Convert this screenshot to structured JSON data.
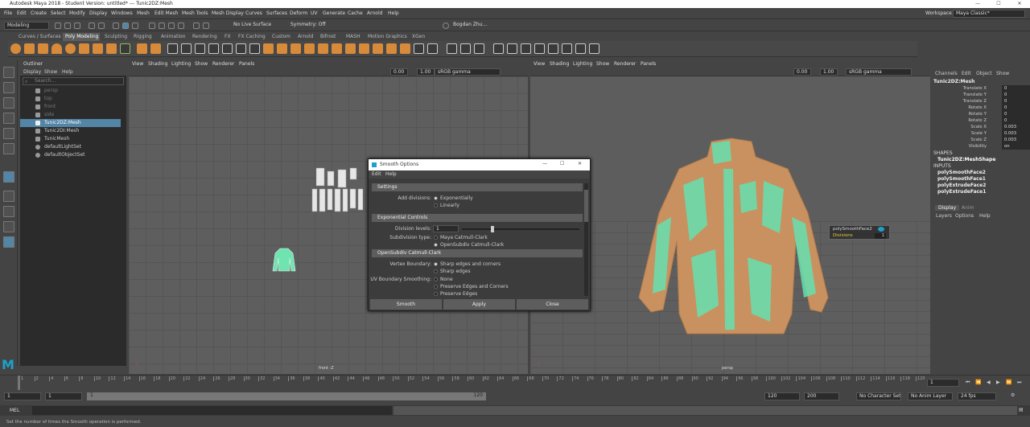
{
  "app": {
    "title": "Autodesk Maya 2018 - Student Version: untitled*   ---   Tunic2DZ:Mesh",
    "accent": "#5285a6"
  },
  "menubar": {
    "items": [
      "File",
      "Edit",
      "Create",
      "Select",
      "Modify",
      "Display",
      "Windows",
      "Mesh",
      "Edit Mesh",
      "Mesh Tools",
      "Mesh Display",
      "Curves",
      "Surfaces",
      "Deform",
      "UV",
      "Generate",
      "Cache",
      "Arnold",
      "Help"
    ],
    "workspace_label": "Workspace :",
    "workspace_value": "Maya Classic*"
  },
  "statusline": {
    "mode": "Modeling",
    "live_surface": "No Live Surface",
    "symmetry": "Symmetry: Off",
    "user": "Bogdan Zhu..."
  },
  "shelf": {
    "tabs": [
      "Curves / Surfaces",
      "Poly Modeling",
      "Sculpting",
      "Rigging",
      "Animation",
      "Rendering",
      "FX",
      "FX Caching",
      "Custom",
      "Arnold",
      "Bifrost",
      "MASH",
      "Motion Graphics",
      "XGen"
    ],
    "active_tab": "Poly Modeling"
  },
  "outliner": {
    "title": "Outliner",
    "menu": [
      "Display",
      "Show",
      "Help"
    ],
    "search_placeholder": "Search...",
    "items": [
      {
        "label": "persp",
        "state": "dim"
      },
      {
        "label": "top",
        "state": "dim"
      },
      {
        "label": "front",
        "state": "dim"
      },
      {
        "label": "side",
        "state": "dim"
      },
      {
        "label": "Tunic2DZ:Mesh",
        "state": "selected"
      },
      {
        "label": "Tunic2DI:Mesh",
        "state": "normal"
      },
      {
        "label": "TunicMesh",
        "state": "normal"
      },
      {
        "label": "defaultLightSet",
        "state": "normal"
      },
      {
        "label": "defaultObjectSet",
        "state": "normal"
      }
    ]
  },
  "viewport_left": {
    "menu": [
      "View",
      "Shading",
      "Lighting",
      "Show",
      "Renderer",
      "Panels"
    ],
    "field1": "0.00",
    "field2": "1.00",
    "colorspace": "sRGB gamma",
    "camera_label": "front -Z"
  },
  "viewport_right": {
    "menu": [
      "View",
      "Shading",
      "Lighting",
      "Show",
      "Renderer",
      "Panels"
    ],
    "field1": "0.00",
    "field2": "1.00",
    "colorspace": "sRGB gamma",
    "camera_label": "persp",
    "hud_title": "polySmoothFace2",
    "hud_attr": "Divisions",
    "hud_value": "1"
  },
  "dialog": {
    "title": "Smooth Options",
    "menu": [
      "Edit",
      "Help"
    ],
    "settings": {
      "header": "Settings",
      "add_divisions_label": "Add divisions:",
      "options": [
        "Exponentially",
        "Linearly"
      ]
    },
    "exponential": {
      "header": "Exponential Controls",
      "levels_label": "Division levels:",
      "levels_value": "1",
      "levels_fraction": 0.25,
      "subdiv_label": "Subdivision type:",
      "subdiv_options": [
        "Maya Catmull-Clark",
        "OpenSubdiv Catmull-Clark"
      ]
    },
    "osd": {
      "header": "OpenSubdiv Catmull-Clark",
      "vertex_label": "Vertex Boundary:",
      "vertex_options": [
        "Sharp edges and corners",
        "Sharp edges"
      ],
      "uv_label": "UV Boundary Smoothing:",
      "uv_options": [
        "None",
        "Preserve Edges and Corners",
        "Preserve Edges"
      ]
    },
    "buttons": {
      "smooth": "Smooth",
      "apply": "Apply",
      "close": "Close"
    }
  },
  "channels": {
    "menu": [
      "Channels",
      "Edit",
      "Object",
      "Show"
    ],
    "object_name": "Tunic2DZ:Mesh",
    "attributes": [
      {
        "name": "Translate X",
        "value": "0"
      },
      {
        "name": "Translate Y",
        "value": "0"
      },
      {
        "name": "Translate Z",
        "value": "0"
      },
      {
        "name": "Rotate X",
        "value": "0"
      },
      {
        "name": "Rotate Y",
        "value": "0"
      },
      {
        "name": "Rotate Z",
        "value": "0"
      },
      {
        "name": "Scale X",
        "value": "0.003"
      },
      {
        "name": "Scale Y",
        "value": "0.003"
      },
      {
        "name": "Scale Z",
        "value": "0.003"
      },
      {
        "name": "Visibility",
        "value": "on"
      }
    ],
    "shapes_header": "SHAPES",
    "shape_name": "Tunic2DZ:MeshShape",
    "inputs_header": "INPUTS",
    "inputs": [
      "polySmoothFace2",
      "polySmoothFace1",
      "polyExtrudeFace2",
      "polyExtrudeFace1"
    ],
    "layer_tabs": [
      "Display",
      "Anim"
    ],
    "layer_menu": [
      "Layers",
      "Options",
      "Help"
    ]
  },
  "timeline": {
    "ticks": [
      "1",
      "2",
      "4",
      "6",
      "8",
      "10",
      "12",
      "14",
      "16",
      "18",
      "20",
      "22",
      "24",
      "26",
      "28",
      "30",
      "32",
      "34",
      "36",
      "38",
      "40",
      "42",
      "44",
      "46",
      "48",
      "50",
      "52",
      "54",
      "56",
      "58",
      "60",
      "62",
      "64",
      "66",
      "68",
      "70",
      "72",
      "74",
      "76",
      "78",
      "80",
      "82",
      "84",
      "86",
      "88",
      "90",
      "92",
      "94",
      "96",
      "98",
      "100",
      "102",
      "104",
      "106",
      "108",
      "110",
      "112",
      "114",
      "116",
      "118",
      "120"
    ],
    "current_frame": "1"
  },
  "range": {
    "start": "1",
    "anim_start": "1",
    "range_start": "1",
    "range_end": "120",
    "end": "120",
    "anim_end": "200",
    "character_set": "No Character Set",
    "anim_layer": "No Anim Layer",
    "fps": "24 fps"
  },
  "cmdline": {
    "label": "MEL"
  },
  "helpline": {
    "text": "Set the number of times the Smooth operation is performed."
  }
}
